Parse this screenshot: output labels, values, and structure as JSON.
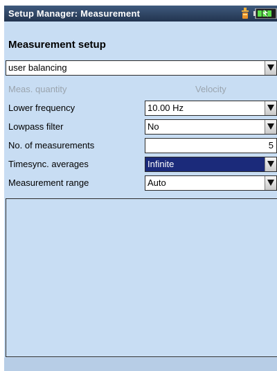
{
  "window": {
    "title": "Setup Manager: Measurement"
  },
  "status_icons": [
    "sensor-icon",
    "battery-icon"
  ],
  "heading": "Measurement setup",
  "profile_select": {
    "value": "user balancing"
  },
  "fields": {
    "meas_quantity": {
      "label": "Meas. quantity",
      "value": "Velocity"
    },
    "lower_frequency": {
      "label": "Lower frequency",
      "value": "10.00 Hz"
    },
    "lowpass_filter": {
      "label": "Lowpass filter",
      "value": "No"
    },
    "num_measurements": {
      "label": "No. of measurements",
      "value": "5"
    },
    "timesync_averages": {
      "label": "Timesync. averages",
      "value": "Infinite"
    },
    "measurement_range": {
      "label": "Measurement range",
      "value": "Auto"
    }
  },
  "colors": {
    "title_bar": "#2c4262",
    "panel": "#c8ddf3",
    "selection": "#1b2a7a",
    "disabled_text": "#9aa4ae"
  }
}
